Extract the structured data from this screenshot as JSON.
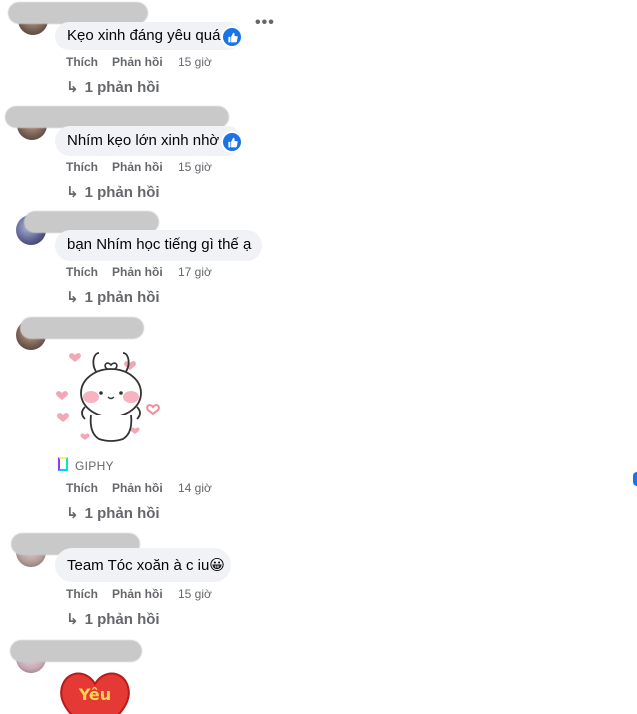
{
  "actions": {
    "like": "Thích",
    "reply": "Phản hồi"
  },
  "comments": [
    {
      "text": "Kẹo xinh đáng yêu quá",
      "time": "15 giờ",
      "replies": "1 phản hồi",
      "reacted": true
    },
    {
      "text": "Nhím kẹo lớn xinh nhờ",
      "time": "15 giờ",
      "replies": "1 phản hồi",
      "reacted": true
    },
    {
      "text": "bạn Nhím học tiếng gì thế ạ",
      "time": "17 giờ",
      "replies": "1 phản hồi",
      "reacted": false
    },
    {
      "text": "",
      "time": "14 giờ",
      "replies": "1 phản hồi",
      "reacted": false,
      "gif_source": "GIPHY"
    },
    {
      "text": "Team Tóc xoăn à c iu😀",
      "time": "15 giờ",
      "replies": "1 phản hồi",
      "reacted": false
    },
    {
      "text": "",
      "time": "",
      "replies": "",
      "reacted": false,
      "sticker": "Yêu"
    }
  ],
  "icons": {
    "reply_arrow": "reply-arrow-icon",
    "more": "more-options-icon",
    "like": "thumbs-up-icon"
  },
  "colors": {
    "bubble": "#f0f2f5",
    "meta_text": "#65676b",
    "like_blue": "#1b74e4",
    "sticker_red": "#e53935"
  }
}
